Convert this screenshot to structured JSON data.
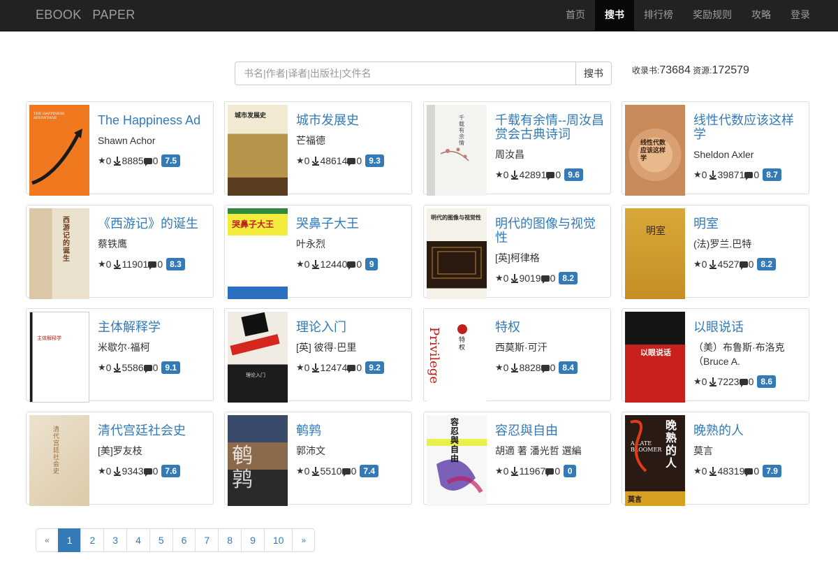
{
  "navbar": {
    "brand": "EBOOK   PAPER",
    "items": [
      {
        "label": "首页",
        "active": false
      },
      {
        "label": "搜书",
        "active": true
      },
      {
        "label": "排行榜",
        "active": false
      },
      {
        "label": "奖励规则",
        "active": false
      },
      {
        "label": "攻略",
        "active": false
      },
      {
        "label": "登录",
        "active": false
      }
    ]
  },
  "search": {
    "placeholder": "书名|作者|译者|出版社|文件名",
    "button": "搜书",
    "books_label": "收录书:",
    "books_count": "73684",
    "resources_label": " 资源:",
    "resources_count": "172579"
  },
  "books": [
    {
      "title": "The Happiness Ad",
      "author": "Shawn Achor",
      "stars": "0",
      "downloads": "8885",
      "comments": "0",
      "rating": "7.5"
    },
    {
      "title": "城市发展史",
      "author": "芒福德",
      "stars": "0",
      "downloads": "48614",
      "comments": "0",
      "rating": "9.3"
    },
    {
      "title": "千载有余情--周汝昌赏会古典诗词",
      "author": "周汝昌",
      "stars": "0",
      "downloads": "42891",
      "comments": "0",
      "rating": "9.6"
    },
    {
      "title": "线性代数应该这样学",
      "author": "Sheldon Axler",
      "stars": "0",
      "downloads": "39871",
      "comments": "0",
      "rating": "8.7"
    },
    {
      "title": "《西游记》的诞生",
      "author": "蔡铁鹰",
      "stars": "0",
      "downloads": "11901",
      "comments": "0",
      "rating": "8.3"
    },
    {
      "title": "哭鼻子大王",
      "author": "叶永烈",
      "stars": "0",
      "downloads": "12440",
      "comments": "0",
      "rating": "9"
    },
    {
      "title": "明代的图像与视觉性",
      "author": "[英]柯律格",
      "stars": "0",
      "downloads": "9019",
      "comments": "0",
      "rating": "8.2"
    },
    {
      "title": "明室",
      "author": "(法)罗兰.巴特",
      "stars": "0",
      "downloads": "4527",
      "comments": "0",
      "rating": "8.2"
    },
    {
      "title": "主体解释学",
      "author": "米歇尔·福柯",
      "stars": "0",
      "downloads": "5586",
      "comments": "0",
      "rating": "9.1"
    },
    {
      "title": "理论入门",
      "author": "[英] 彼得·巴里",
      "stars": "0",
      "downloads": "12474",
      "comments": "0",
      "rating": "9.2"
    },
    {
      "title": "特权",
      "author": "西莫斯·可汗",
      "stars": "0",
      "downloads": "8828",
      "comments": "0",
      "rating": "8.4"
    },
    {
      "title": "以眼说话",
      "author": "（美）布鲁斯·布洛克（Bruce A.",
      "stars": "0",
      "downloads": "7223",
      "comments": "0",
      "rating": "8.6"
    },
    {
      "title": "清代宫廷社会史",
      "author": "[美]罗友枝",
      "stars": "0",
      "downloads": "9343",
      "comments": "0",
      "rating": "7.6"
    },
    {
      "title": "鹌鹑",
      "author": "郭沛文",
      "stars": "0",
      "downloads": "5510",
      "comments": "0",
      "rating": "7.4"
    },
    {
      "title": "容忍與自由",
      "author": "胡適 著 潘光哲 選編",
      "stars": "0",
      "downloads": "11967",
      "comments": "0",
      "rating": "0"
    },
    {
      "title": "晚熟的人",
      "author": "莫言",
      "stars": "0",
      "downloads": "48319",
      "comments": "0",
      "rating": "7.9"
    }
  ],
  "covers": {
    "c1": "THE HAPPINESS ADVANTAGE",
    "c2": "城市发展史",
    "c3": "千载有余情",
    "c4": "线性代数应该这样学",
    "c5": "西游记的诞生",
    "c6": "哭鼻子大王",
    "c7": "明代的图像与视觉性",
    "c8": "明室",
    "c9": "主体解释学",
    "c10": "理论入门",
    "c11a": "Privilege",
    "c11b": "特权",
    "c12": "以眼说话",
    "c13": "清代宫廷社会史",
    "c14": "鹌鹑",
    "c15": "容忍與自由",
    "c16a": "晚熟的人",
    "c16b": "A LATE BLOOMER",
    "c16c": "莫言"
  },
  "pagination": {
    "prev": "«",
    "next": "»",
    "pages": [
      "1",
      "2",
      "3",
      "4",
      "5",
      "6",
      "7",
      "8",
      "9",
      "10"
    ],
    "current": "1"
  }
}
